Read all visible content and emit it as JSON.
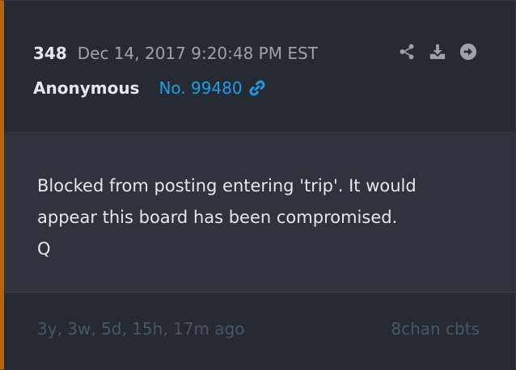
{
  "post": {
    "number": "348",
    "timestamp": "Dec 14, 2017 9:20:48 PM EST",
    "author": "Anonymous",
    "link_text": "No. 99480",
    "message": "Blocked from posting entering 'trip'. It would\nappear this board has been compromised.\nQ",
    "age": "3y, 3w, 5d, 15h, 17m ago",
    "source": "8chan cbts"
  },
  "icons": {
    "share": "share-icon",
    "download": "download-icon",
    "goto": "arrow-circle-right-icon",
    "link": "link-icon"
  },
  "colors": {
    "accent_border": "#b8650f",
    "link": "#1e9de8",
    "background": "#262a33",
    "body_background": "#2e333d"
  }
}
